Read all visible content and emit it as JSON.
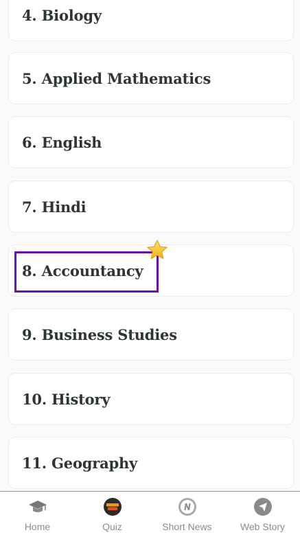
{
  "subjects": [
    {
      "label": "4. Biology"
    },
    {
      "label": "5. Applied Mathematics"
    },
    {
      "label": "6. English"
    },
    {
      "label": "7. Hindi"
    },
    {
      "label": "8. Accountancy"
    },
    {
      "label": "9. Business Studies"
    },
    {
      "label": "10. History"
    },
    {
      "label": "11. Geography"
    }
  ],
  "highlighted_item": "8. Accountancy",
  "highlight_color": "#6a0fb8",
  "bottom_nav": {
    "items": [
      {
        "label": "Home",
        "icon": "graduation-cap-icon"
      },
      {
        "label": "Quiz",
        "icon": "quiz-badge-icon"
      },
      {
        "label": "Short News",
        "icon": "news-n-icon"
      },
      {
        "label": "Web Story",
        "icon": "navigation-arrow-icon"
      }
    ]
  }
}
